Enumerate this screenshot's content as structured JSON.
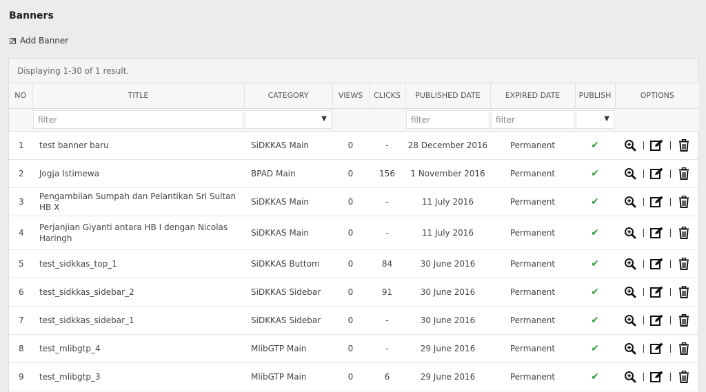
{
  "page": {
    "title": "Banners",
    "add_label": "Add Banner"
  },
  "grid": {
    "summary": "Displaying 1-30 of 1 result.",
    "columns": [
      "NO",
      "TITLE",
      "CATEGORY",
      "VIEWS",
      "CLICKS",
      "PUBLISHED DATE",
      "EXPIRED DATE",
      "PUBLISH",
      "OPTIONS"
    ],
    "filters": {
      "title_placeholder": "filter",
      "published_placeholder": "filter",
      "expired_placeholder": "filter",
      "category_value": "",
      "publish_value": ""
    },
    "rows": [
      {
        "no": "1",
        "title": "test banner baru",
        "category": "SiDKKAS Main",
        "views": "0",
        "clicks": "-",
        "published": "28 December 2016",
        "expired": "Permanent",
        "publish": "✔"
      },
      {
        "no": "2",
        "title": "Jogja Istimewa",
        "category": "BPAD Main",
        "views": "0",
        "clicks": "156",
        "published": "1 November 2016",
        "expired": "Permanent",
        "publish": "✔"
      },
      {
        "no": "3",
        "title": "Pengambilan Sumpah dan Pelantikan Sri Sultan HB X",
        "category": "SiDKKAS Main",
        "views": "0",
        "clicks": "-",
        "published": "11 July 2016",
        "expired": "Permanent",
        "publish": "✔"
      },
      {
        "no": "4",
        "title": "Perjanjian Giyanti antara HB I dengan Nicolas Haringh",
        "category": "SiDKKAS Main",
        "views": "0",
        "clicks": "-",
        "published": "11 July 2016",
        "expired": "Permanent",
        "publish": "✔"
      },
      {
        "no": "5",
        "title": "test_sidkkas_top_1",
        "category": "SiDKKAS Buttom",
        "views": "0",
        "clicks": "84",
        "published": "30 June 2016",
        "expired": "Permanent",
        "publish": "✔"
      },
      {
        "no": "6",
        "title": "test_sidkkas_sidebar_2",
        "category": "SiDKKAS Sidebar",
        "views": "0",
        "clicks": "91",
        "published": "30 June 2016",
        "expired": "Permanent",
        "publish": "✔"
      },
      {
        "no": "7",
        "title": "test_sidkkas_sidebar_1",
        "category": "SiDKKAS Sidebar",
        "views": "0",
        "clicks": "-",
        "published": "30 June 2016",
        "expired": "Permanent",
        "publish": "✔"
      },
      {
        "no": "8",
        "title": "test_mlibgtp_4",
        "category": "MlibGTP Main",
        "views": "0",
        "clicks": "-",
        "published": "29 June 2016",
        "expired": "Permanent",
        "publish": "✔"
      },
      {
        "no": "9",
        "title": "test_mlibgtp_3",
        "category": "MlibGTP Main",
        "views": "0",
        "clicks": "6",
        "published": "29 June 2016",
        "expired": "Permanent",
        "publish": "✔"
      }
    ],
    "option_icons": [
      "zoom-in-icon",
      "edit-icon",
      "trash-icon"
    ]
  },
  "colors": {
    "background": "#ececec",
    "check": "#2e9e3a"
  }
}
